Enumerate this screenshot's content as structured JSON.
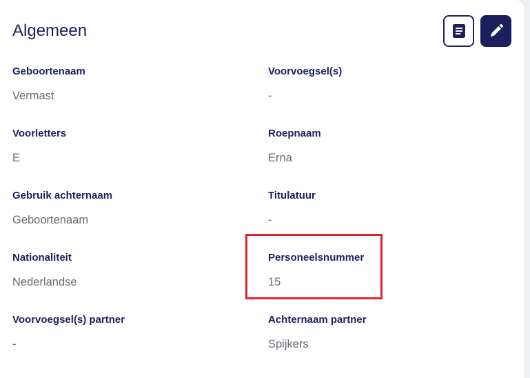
{
  "section": {
    "title": "Algemeen"
  },
  "actions": {
    "notes_icon": "document-icon",
    "edit_icon": "pencil-icon",
    "accent": "#1b1f5e"
  },
  "fields": {
    "geboortenaam": {
      "label": "Geboortenaam",
      "value": "Vermast"
    },
    "voorvoegsels": {
      "label": "Voorvoegsel(s)",
      "value": "-"
    },
    "voorletters": {
      "label": "Voorletters",
      "value": "E"
    },
    "roepnaam": {
      "label": "Roepnaam",
      "value": "Erna"
    },
    "gebruik_achternaam": {
      "label": "Gebruik achternaam",
      "value": "Geboortenaam"
    },
    "titulatuur": {
      "label": "Titulatuur",
      "value": "-"
    },
    "nationaliteit": {
      "label": "Nationaliteit",
      "value": "Nederlandse"
    },
    "personeelsnummer": {
      "label": "Personeelsnummer",
      "value": "15"
    },
    "voorvoegsels_partner": {
      "label": "Voorvoegsel(s) partner",
      "value": "-"
    },
    "achternaam_partner": {
      "label": "Achternaam partner",
      "value": "Spijkers"
    }
  },
  "highlight": {
    "color": "#e0202a"
  }
}
